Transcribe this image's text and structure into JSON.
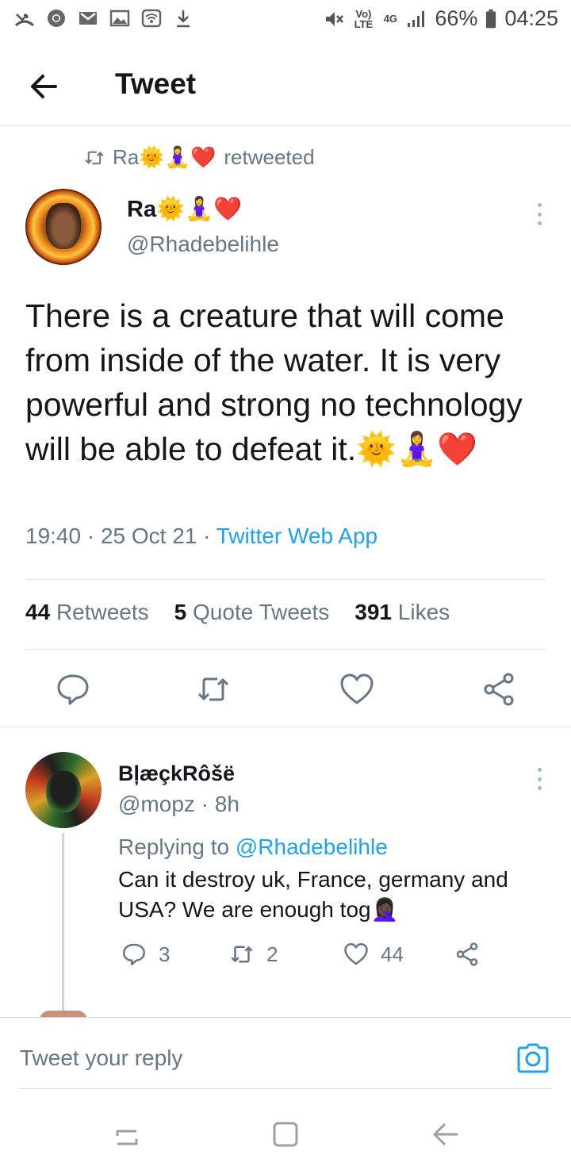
{
  "status_bar": {
    "battery": "66%",
    "time": "04:25",
    "volte": "Vo) LTE",
    "network": "4G",
    "icons": [
      "missed-call-icon",
      "chrome-icon",
      "gmail-icon",
      "gallery-icon",
      "wifi-icon",
      "download-icon",
      "mute-icon",
      "signal-icon",
      "battery-icon"
    ]
  },
  "header": {
    "title": "Tweet"
  },
  "retweet": {
    "name": "Ra",
    "emojis": "🌞🧘‍♀️❤️",
    "label": "retweeted"
  },
  "tweet": {
    "author_name": "Ra",
    "author_emojis": "🌞🧘‍♀️❤️",
    "handle": "@Rhadebelihle",
    "text": "There is a creature that will come from inside of the water. It is very powerful and strong no technology will be able to defeat it.",
    "text_emojis": "🌞🧘‍♀️❤️",
    "time": "19:40 · 25 Oct 21 · ",
    "source": "Twitter Web App",
    "retweets_count": "44",
    "retweets_label": "Retweets",
    "quotes_count": "5",
    "quotes_label": "Quote Tweets",
    "likes_count": "391",
    "likes_label": "Likes"
  },
  "reply": {
    "name": "BļæçkRôšë",
    "handle_time": "@mopz · 8h",
    "replying_prefix": "Replying to ",
    "replying_to": "@Rhadebelihle",
    "text": "Can it destroy uk, France, germany and USA? We are enough tog",
    "text_emoji": "🤦🏿‍♀️",
    "reply_count": "3",
    "retweet_count": "2",
    "like_count": "44"
  },
  "composer": {
    "placeholder": "Tweet your reply"
  },
  "colors": {
    "link": "#1da1f2",
    "secondary_text": "#657786",
    "divider": "#e1e8ed"
  }
}
